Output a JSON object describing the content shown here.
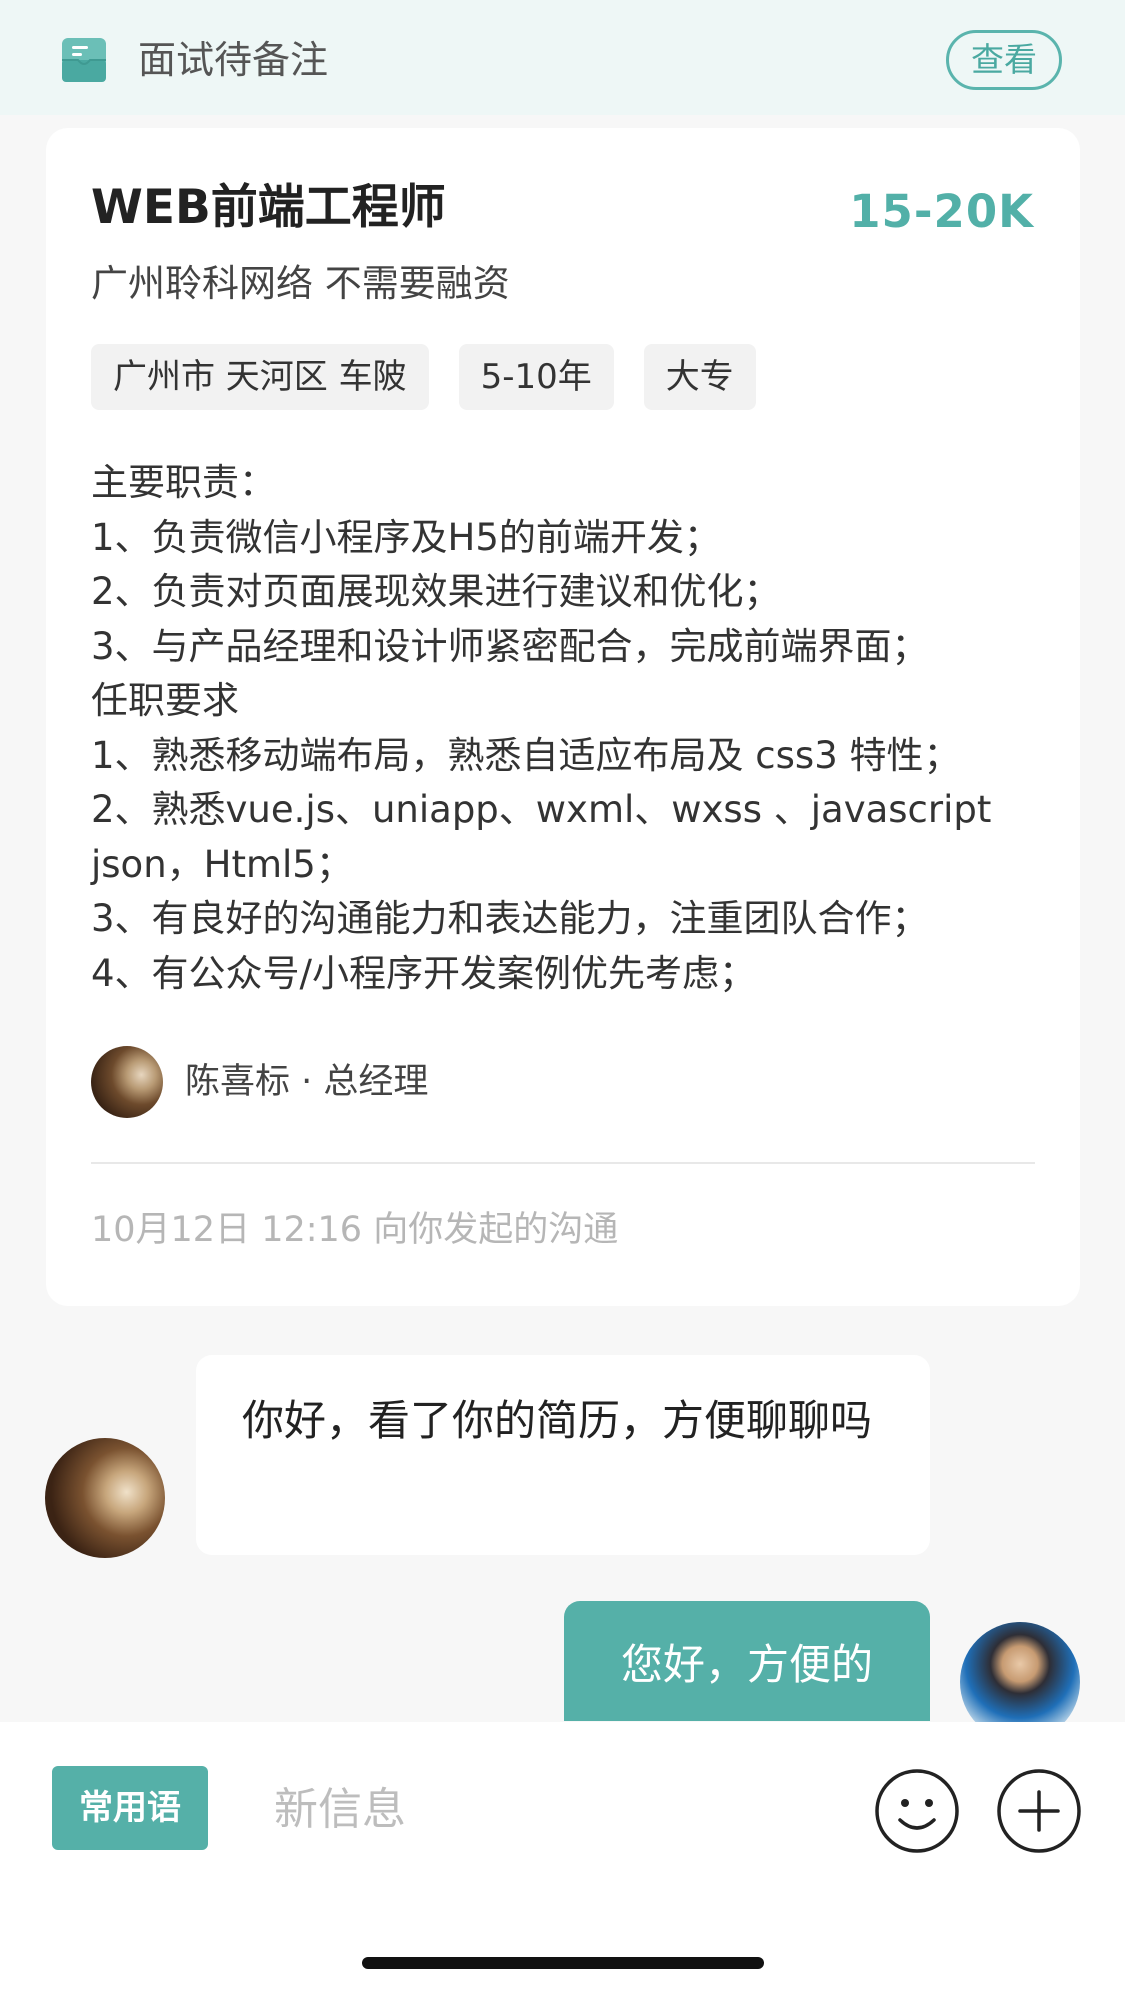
{
  "banner": {
    "title": "面试待备注",
    "view_label": "查看",
    "icon": "note-box-icon"
  },
  "job": {
    "title": "WEB前端工程师",
    "salary": "15-20K",
    "company": "广州聆科网络 不需要融资",
    "tags": [
      "广州市 天河区 车陂",
      "5-10年",
      "大专"
    ],
    "description": "主要职责：\n1、负责微信小程序及H5的前端开发；\n2、负责对页面展现效果进行建议和优化；\n3、与产品经理和设计师紧密配合，完成前端界面；\n任职要求\n1、熟悉移动端布局，熟悉自适应布局及 css3 特性；\n2、熟悉vue.js、uniapp、wxml、wxss 、javascript json，Html5；\n3、有良好的沟通能力和表达能力，注重团队合作；\n4、有公众号/小程序开发案例优先考虑；",
    "recruiter": "陈喜标 · 总经理",
    "time_note": "10月12日 12:16 向你发起的沟通"
  },
  "messages": [
    {
      "side": "left",
      "text": "你好，看了你的简历，方便聊聊吗"
    },
    {
      "side": "right",
      "text": "您好，方便的"
    }
  ],
  "input_bar": {
    "phrase_label": "常用语",
    "placeholder": "新信息",
    "emoji_icon": "smiley-icon",
    "plus_icon": "plus-circle-icon"
  },
  "colors": {
    "accent": "#55b0a8",
    "banner_bg": "#eef7f6",
    "page_bg": "#f7f7f7"
  }
}
